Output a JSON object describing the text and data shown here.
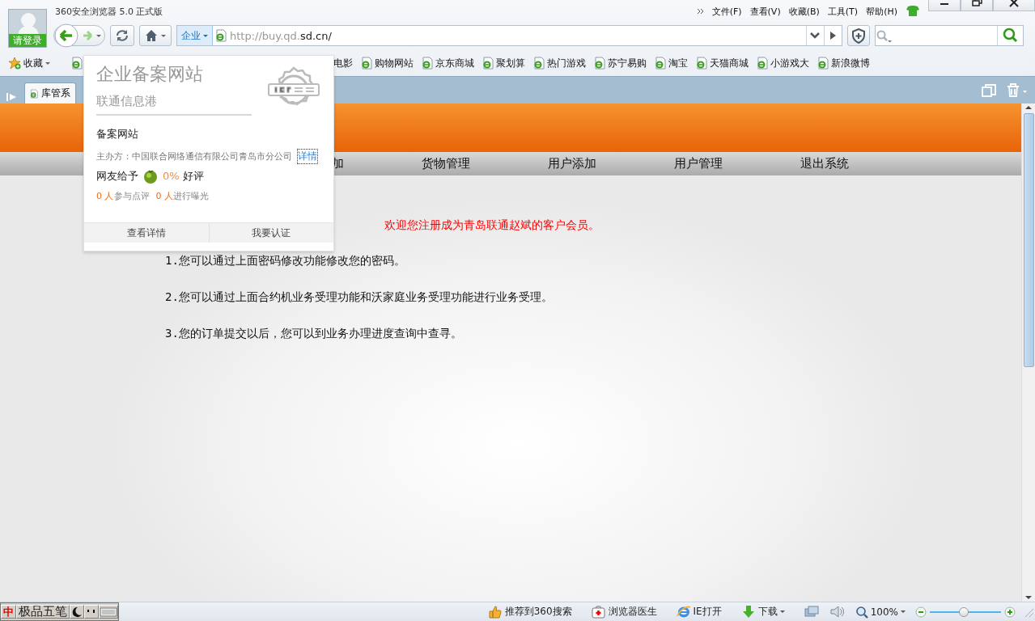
{
  "window": {
    "title": "360安全浏览器 5.0 正式版",
    "login": "请登录",
    "menu": [
      "文件(F)",
      "查看(V)",
      "收藏(B)",
      "工具(T)",
      "帮助(H)"
    ]
  },
  "toolbar": {
    "site_badge": "企业",
    "address_prefix": "http://buy.qd.",
    "address_domain": "sd.cn/"
  },
  "bookmarks": {
    "favorites": "收藏",
    "items": [
      "电影",
      "购物网站",
      "京东商城",
      "聚划算",
      "热门游戏",
      "苏宁易购",
      "淘宝",
      "天猫商城",
      "小游戏大",
      "新浪微博"
    ]
  },
  "tabs": [
    {
      "label": "库管系",
      "selected": true
    }
  ],
  "page": {
    "nav": [
      "加",
      "货物管理",
      "用户添加",
      "用户管理",
      "退出系统"
    ],
    "welcome": "欢迎您注册成为青岛联通赵斌的客户会员。",
    "notes": [
      "1.您可以通过上面密码修改功能修改您的密码。",
      "2.您可以通过上面合约机业务受理功能和沃家庭业务受理功能进行业务受理。",
      "3.您的订单提交以后，您可以到业务办理进度查询中查寻。"
    ]
  },
  "popup": {
    "title": "企业备案网站",
    "subtitle": "联通信息港",
    "section": "备案网站",
    "sponsor": "主办方：中国联合网络通信有限公司青岛市分公司",
    "detail_link": "详情",
    "rating_label": "网友给予",
    "rating": "0%",
    "rating_suffix": "好评",
    "stats": [
      {
        "count": "0 人",
        "text": "参与点评"
      },
      {
        "count": "0 人",
        "text": "进行曝光"
      }
    ],
    "buttons": [
      "查看详情",
      "我要认证"
    ]
  },
  "status_bar": {
    "ime": "中",
    "ime_name": "极品五笔",
    "items": [
      {
        "kind": "recommend",
        "label": "推荐到360搜索"
      },
      {
        "kind": "doctor",
        "label": "浏览器医生"
      },
      {
        "kind": "ie",
        "label": "IE打开"
      },
      {
        "kind": "download",
        "label": "下载"
      }
    ],
    "zoom": "100%",
    "zoom_slider": {
      "level": 0.48
    }
  }
}
